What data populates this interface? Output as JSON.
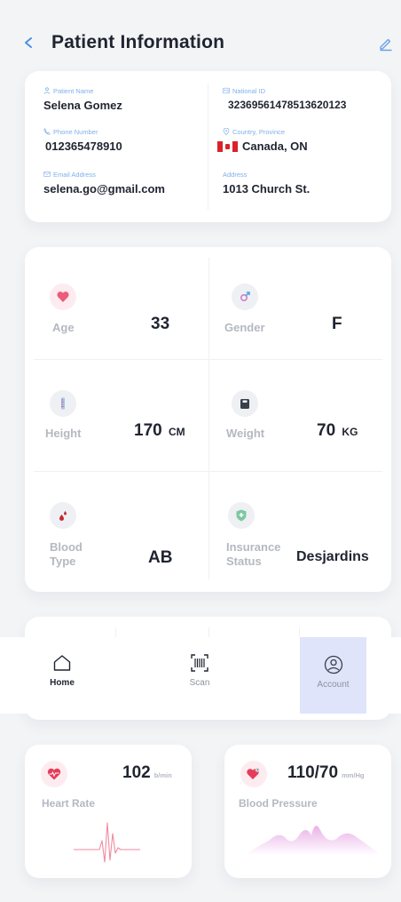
{
  "header": {
    "title": "Patient Information",
    "back_icon": "chevron-left-icon",
    "edit_icon": "pencil-icon"
  },
  "patient": {
    "name_label": "Patient Name",
    "name": "Selena Gomez",
    "national_id_label": "National ID",
    "national_id": "32369561478513620123",
    "phone_label": "Phone Number",
    "phone": "012365478910",
    "country_label": "Country, Province",
    "country": "Canada, ON",
    "email_label": "Email Address",
    "email": "selena.go@gmail.com",
    "address_label": "Address",
    "address": "1013 Church St."
  },
  "stats": {
    "age_label": "Age",
    "age": "33",
    "gender_label": "Gender",
    "gender": "F",
    "height_label": "Height",
    "height": "170",
    "height_unit": "CM",
    "weight_label": "Weight",
    "weight": "70",
    "weight_unit": "KG",
    "blood_label_1": "Blood",
    "blood_label_2": "Type",
    "blood": "AB",
    "insurance_label_1": "Insurance",
    "insurance_label_2": "Status",
    "insurance": "Desjardins"
  },
  "nav": {
    "home": "Home",
    "scan": "Scan",
    "account": "Account"
  },
  "vitals": {
    "heart_value": "102",
    "heart_unit": "b/min",
    "heart_label": "Heart Rate",
    "bp_value": "110/70",
    "bp_unit": "mm/Hg",
    "bp_label": "Blood Pressure"
  },
  "colors": {
    "accent": "#4a90e2",
    "label_blue": "#7fb0e8",
    "heart_red": "#e63c5a",
    "nav_selected": "#dfe4fa",
    "bp_gradient": "#e8a8e6"
  }
}
